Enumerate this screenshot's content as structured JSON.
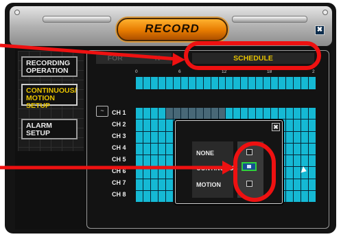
{
  "window": {
    "title": "RECORD",
    "close_label": "✖"
  },
  "menu": {
    "items": [
      {
        "label": "RECORDING OPERATION"
      },
      {
        "label": "CONTINUOUS/ MOTION SETUP"
      },
      {
        "label": "ALARM SETUP"
      }
    ]
  },
  "tabs": {
    "previous_label": "FOR",
    "previous_label_tail": "N",
    "schedule_label": "SCHEDULE"
  },
  "hours": [
    "0",
    "6",
    "12",
    "18",
    "2"
  ],
  "channels": [
    "CH 1",
    "CH 2",
    "CH 3",
    "CH 4",
    "CH 5",
    "CH 6",
    "CH 7",
    "CH 8"
  ],
  "popup": {
    "close_label": "✖",
    "options": [
      {
        "label": "NONE",
        "selected": false
      },
      {
        "label": "CONTINUOUS",
        "selected": true
      },
      {
        "label": "MOTION",
        "selected": false
      }
    ]
  },
  "colors": {
    "title_pill": "#f08a00",
    "schedule_cell": "#15b9d4",
    "highlight": "#ee1111",
    "selected_text": "#e5c200"
  },
  "icons": {
    "channel_select": "tv-icon",
    "cursor": "mouse-pointer-icon"
  }
}
